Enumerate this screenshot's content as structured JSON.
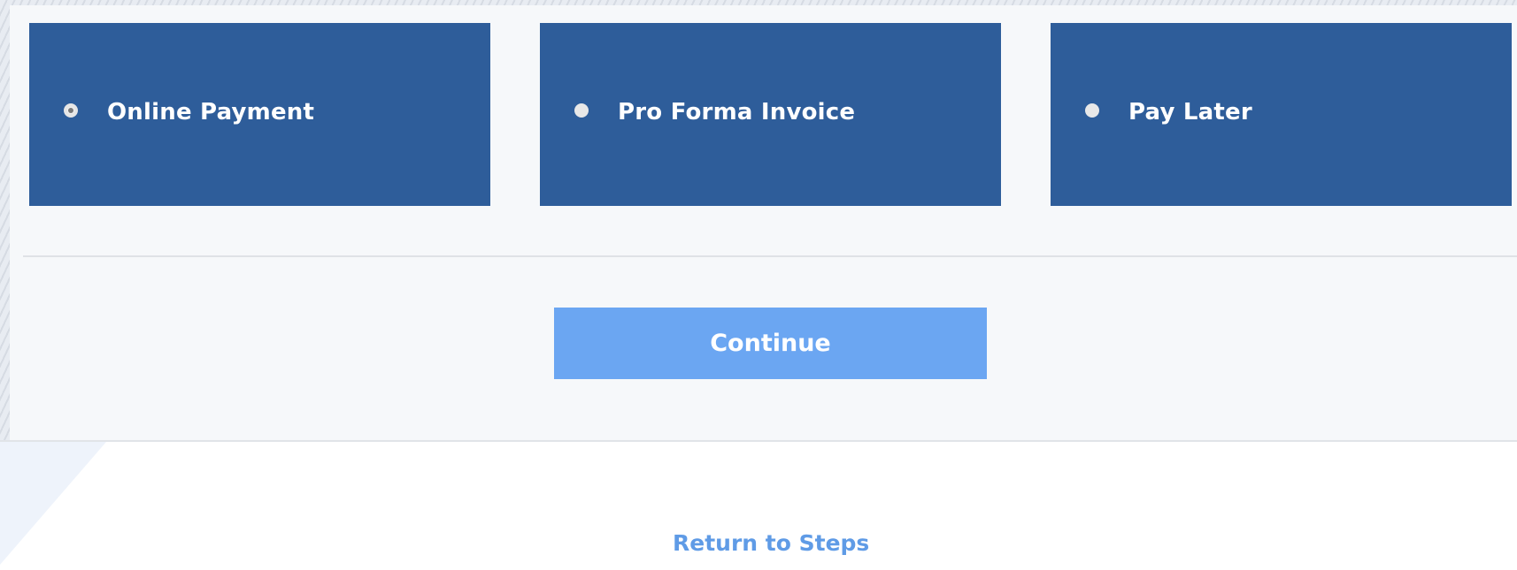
{
  "payment_options": [
    {
      "label": "Online Payment",
      "selected": true
    },
    {
      "label": "Pro Forma Invoice",
      "selected": false
    },
    {
      "label": "Pay Later",
      "selected": false
    }
  ],
  "actions": {
    "continue_label": "Continue",
    "return_label": "Return to Steps"
  },
  "colors": {
    "option_background": "#2e5d9a",
    "continue_button": "#6ba6f2",
    "link": "#5f9be6",
    "panel_background": "#f6f8fa"
  }
}
